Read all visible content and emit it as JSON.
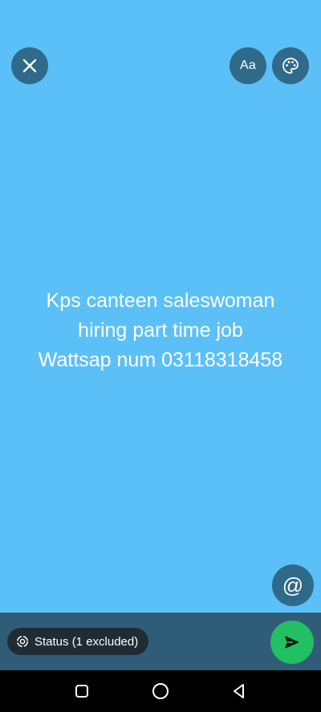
{
  "toolbar": {
    "close_icon": "close-icon",
    "text_style_label": "Aa",
    "palette_icon": "palette-icon"
  },
  "status": {
    "background_color": "#5bc0f8",
    "lines": [
      "Kps canteen saleswoman",
      "hiring part time job",
      "Wattsap num 03118318458"
    ]
  },
  "mention": {
    "label": "@"
  },
  "audience": {
    "icon": "status-ring-icon",
    "label": "Status (1 excluded)"
  },
  "send": {
    "icon": "send-icon",
    "color": "#21c063"
  },
  "nav": {
    "recents_icon": "recents-square-icon",
    "home_icon": "home-circle-icon",
    "back_icon": "back-triangle-icon"
  }
}
